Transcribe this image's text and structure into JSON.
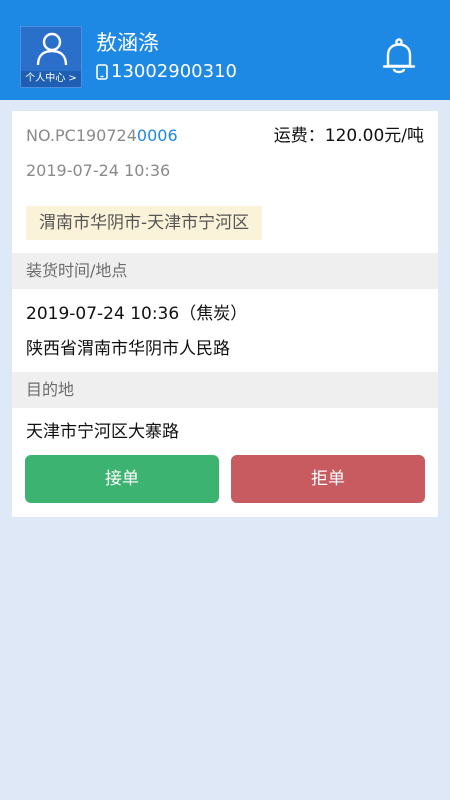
{
  "user": {
    "avatar_label": "个人中心 >",
    "name": "敖涵涤",
    "phone": "13002900310"
  },
  "order": {
    "no_prefix": "NO.PC190724",
    "no_highlight": "0006",
    "fee": "运费：120.00元/吨",
    "created_at": "2019-07-24 10:36",
    "route": "渭南市华阴市-天津市宁河区",
    "loading_title": "装货时间/地点",
    "loading_time": "2019-07-24 10:36（焦炭）",
    "loading_address": "陕西省渭南市华阴市人民路",
    "destination_title": "目的地",
    "destination_address": "天津市宁河区大寨路"
  },
  "actions": {
    "accept_label": "接单",
    "reject_label": "拒单"
  },
  "colors": {
    "header": "#1e88e5",
    "accept": "#3cb371",
    "reject": "#c75b5f",
    "background": "#dfe8f6",
    "route_tag": "#fbf3d9"
  },
  "icons": {
    "avatar": "user-icon",
    "phone": "phone-icon",
    "notification": "bell-icon"
  }
}
